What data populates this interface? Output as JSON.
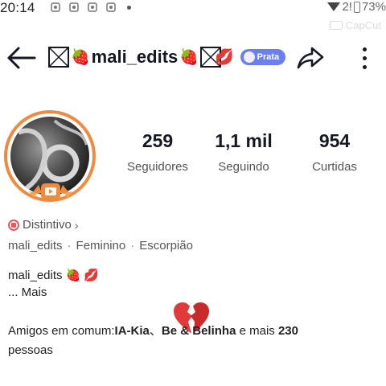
{
  "status": {
    "time": "20:14",
    "battery_text": "73%",
    "signal_text": "2!"
  },
  "watermark": "CapCut",
  "header": {
    "username": "mali_edits",
    "strawberry": "🍓",
    "lips": "💋",
    "badge": "Prata"
  },
  "stats": [
    {
      "value": "259",
      "label": "Seguidores"
    },
    {
      "value": "1,1 mil",
      "label": "Seguindo"
    },
    {
      "value": "954",
      "label": "Curtidas"
    }
  ],
  "bio": {
    "distintivo": "Distintivo",
    "chevron": "›",
    "meta": [
      "mali_edits",
      "Feminino",
      "Escorpião"
    ],
    "meta_sep": "·",
    "line1": "mali_edits",
    "line1_emojis": "🍓 💋",
    "more": "...  Mais",
    "friends_prefix": "Amigos em comum:",
    "friend1": "IA-Kia",
    "friend_sep": "、",
    "friend2": "Be & Belinha",
    "friends_mid": " e mais ",
    "friends_count": "230",
    "friends_suffix": "pessoas"
  },
  "colors": {
    "accent_ring": "#f08a3e",
    "badge_bg": "#6b7ff0",
    "distintivo": "#e8575b"
  }
}
